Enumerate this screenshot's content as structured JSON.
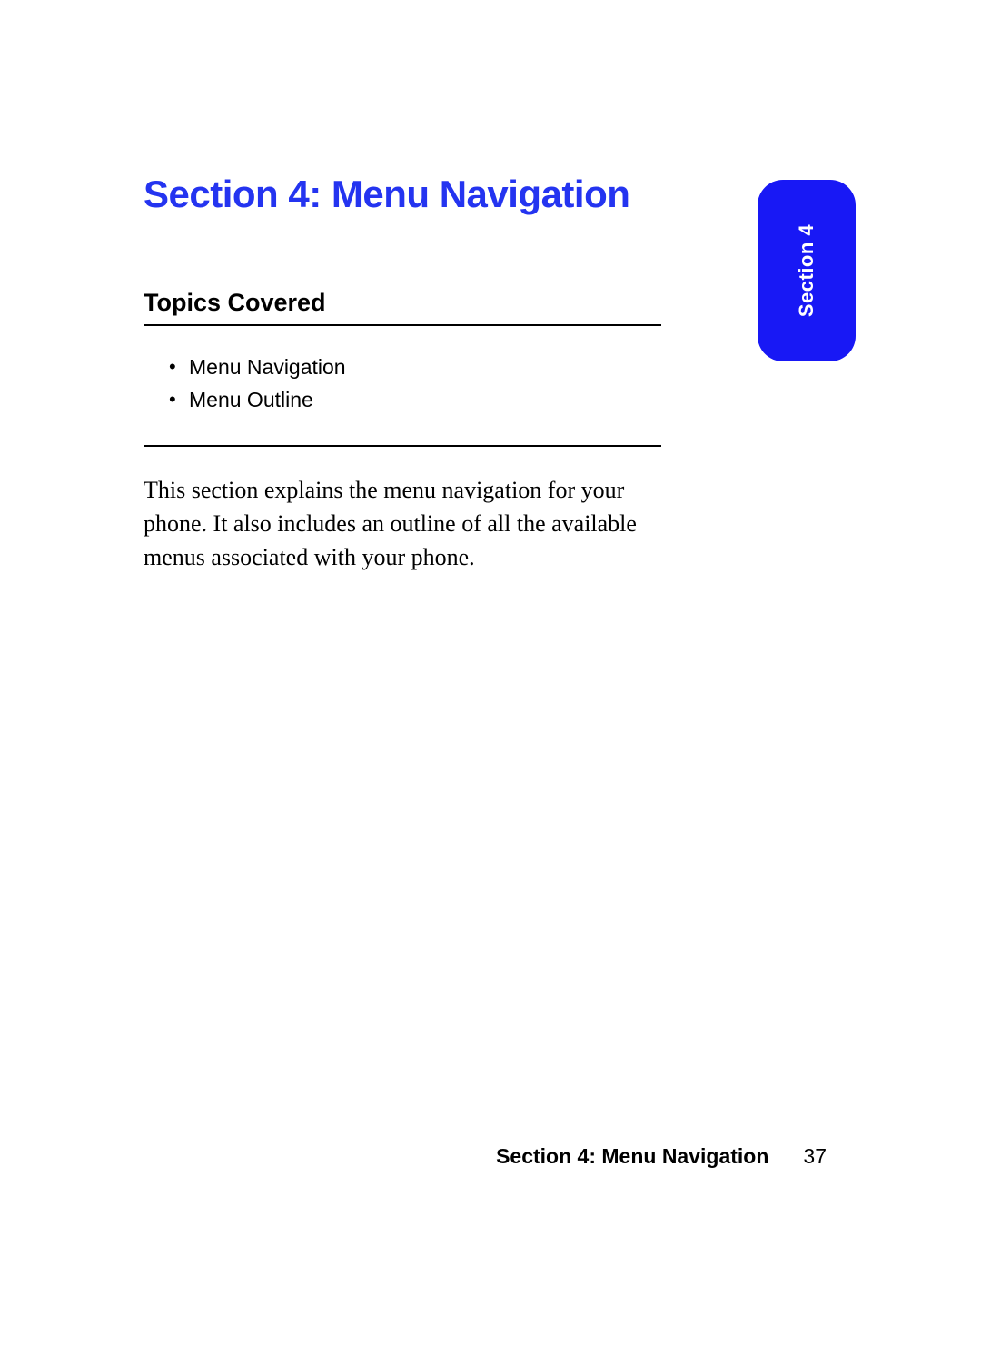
{
  "section": {
    "title": "Section 4: Menu Navigation",
    "subsectionTitle": "Topics Covered",
    "topics": [
      "Menu Navigation",
      "Menu Outline"
    ],
    "bodyText": "This section explains the menu navigation for your phone. It also includes an outline of all the available menus associated with your phone."
  },
  "tab": {
    "label": "Section 4"
  },
  "footer": {
    "title": "Section 4: Menu Navigation",
    "pageNumber": "37"
  }
}
